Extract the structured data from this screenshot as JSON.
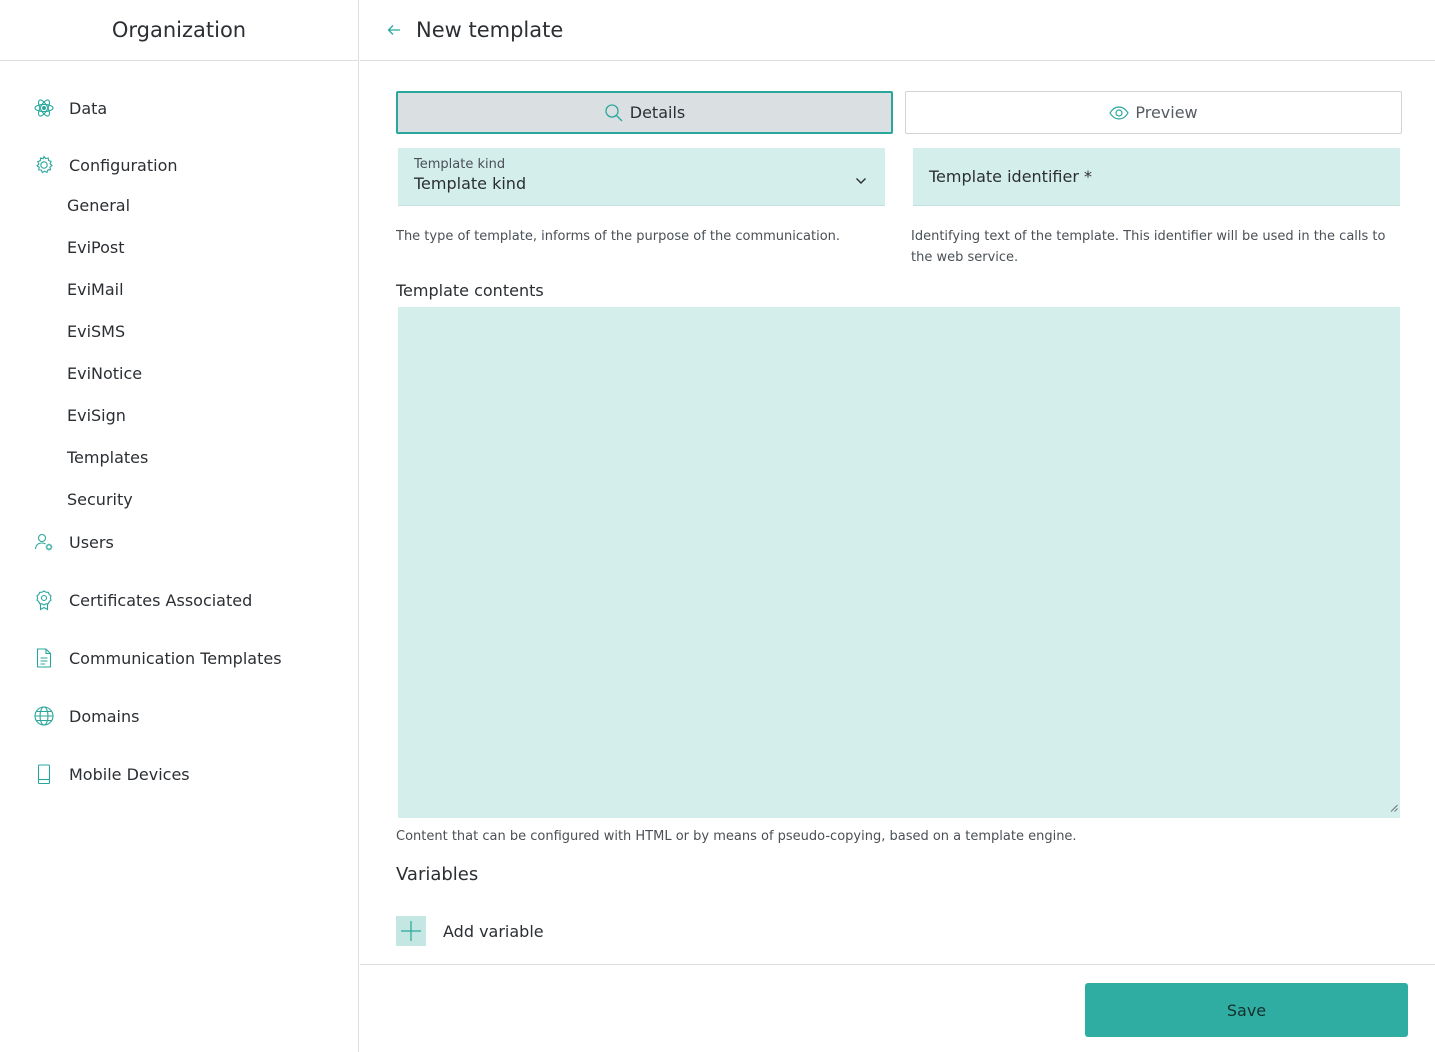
{
  "sidebar": {
    "title": "Organization",
    "items": [
      {
        "label": "Data",
        "icon": "atom-icon"
      },
      {
        "label": "Configuration",
        "icon": "gear-icon"
      },
      {
        "label": "Users",
        "icon": "user-gear-icon"
      },
      {
        "label": "Certificates Associated",
        "icon": "certificate-icon"
      },
      {
        "label": "Communication Templates",
        "icon": "document-icon"
      },
      {
        "label": "Domains",
        "icon": "globe-icon"
      },
      {
        "label": "Mobile Devices",
        "icon": "mobile-icon"
      }
    ],
    "config_subitems": [
      "General",
      "EviPost",
      "EviMail",
      "EviSMS",
      "EviNotice",
      "EviSign",
      "Templates",
      "Security"
    ]
  },
  "header": {
    "title": "New template"
  },
  "tabs": {
    "details": "Details",
    "preview": "Preview"
  },
  "form": {
    "template_kind_label": "Template kind",
    "template_kind_value": "Template kind",
    "template_kind_help": "The type of template, informs of the purpose of the communication.",
    "identifier_placeholder": "Template identifier *",
    "identifier_help": "Identifying text of the template. This identifier will be used in the calls to the web service.",
    "contents_label": "Template contents",
    "contents_help": "Content that can be configured with HTML or by means of pseudo-copying, based on a template engine."
  },
  "variables": {
    "title": "Variables",
    "add_label": "Add variable"
  },
  "footer": {
    "save_label": "Save"
  },
  "colors": {
    "accent": "#30ada3",
    "field_bg": "#d4eeec",
    "icon_teal": "#2aa79c"
  }
}
